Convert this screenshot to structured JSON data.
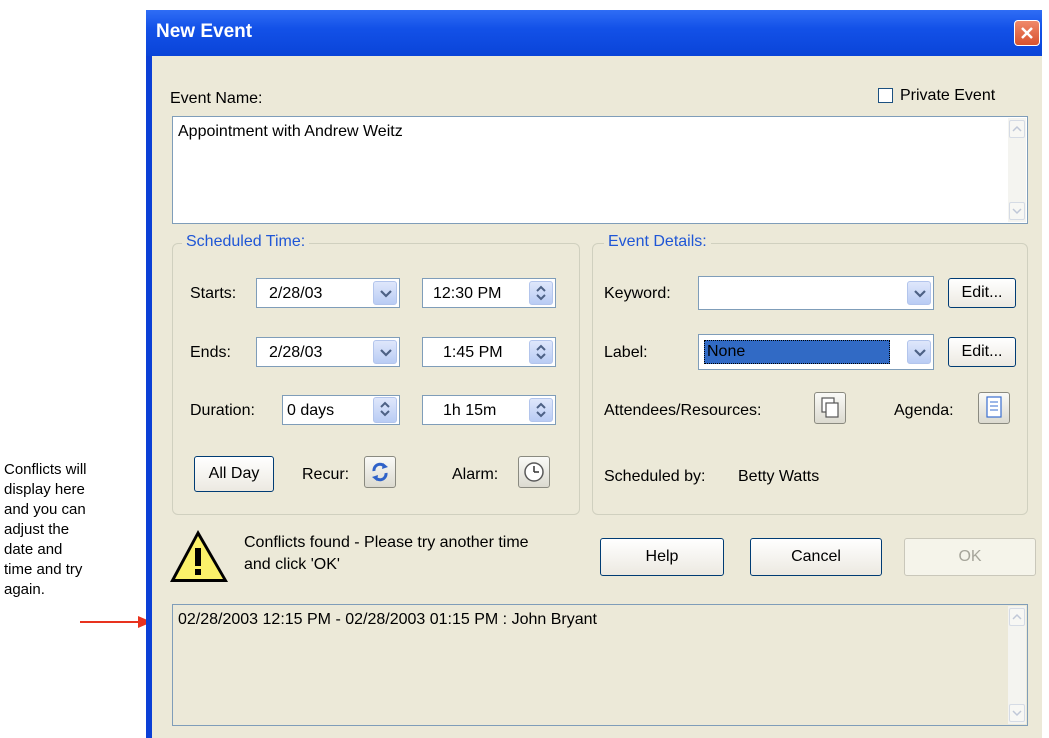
{
  "annotation": {
    "lines": [
      "Conflicts will",
      "display here",
      "and you can",
      "adjust the",
      "date and",
      "time and try",
      "again."
    ]
  },
  "window": {
    "title": "New Event"
  },
  "event": {
    "name_label": "Event Name:",
    "private_label": "Private Event",
    "private_checked": false,
    "name_value": "Appointment with Andrew Weitz"
  },
  "scheduled": {
    "title": "Scheduled Time:",
    "starts_label": "Starts:",
    "starts_date": "2/28/03",
    "starts_time": "12:30 PM",
    "ends_label": "Ends:",
    "ends_date": "2/28/03",
    "ends_time": "1:45 PM",
    "duration_label": "Duration:",
    "duration_days": "0 days",
    "duration_time": "1h 15m",
    "allday_label": "All Day",
    "recur_label": "Recur:",
    "alarm_label": "Alarm:"
  },
  "details": {
    "title": "Event Details:",
    "keyword_label": "Keyword:",
    "keyword_value": "",
    "edit_label": "Edit...",
    "label_label": "Label:",
    "label_value": "None",
    "attendees_label": "Attendees/Resources:",
    "agenda_label": "Agenda:",
    "scheduled_by_label": "Scheduled by:",
    "scheduled_by_value": "Betty Watts"
  },
  "conflict": {
    "message_line1": "Conflicts found - Please try another time",
    "message_line2": "and click 'OK'",
    "list": [
      "02/28/2003 12:15 PM - 02/28/2003 01:15 PM : John Bryant"
    ]
  },
  "buttons": {
    "help": "Help",
    "cancel": "Cancel",
    "ok": "OK"
  },
  "colors": {
    "title_bar": "#0a44d8",
    "dialog_bg": "#ece9d8",
    "group_title": "#1f56d6",
    "selected_field": "#316ac5",
    "annotation_arrow": "#e8321e"
  }
}
